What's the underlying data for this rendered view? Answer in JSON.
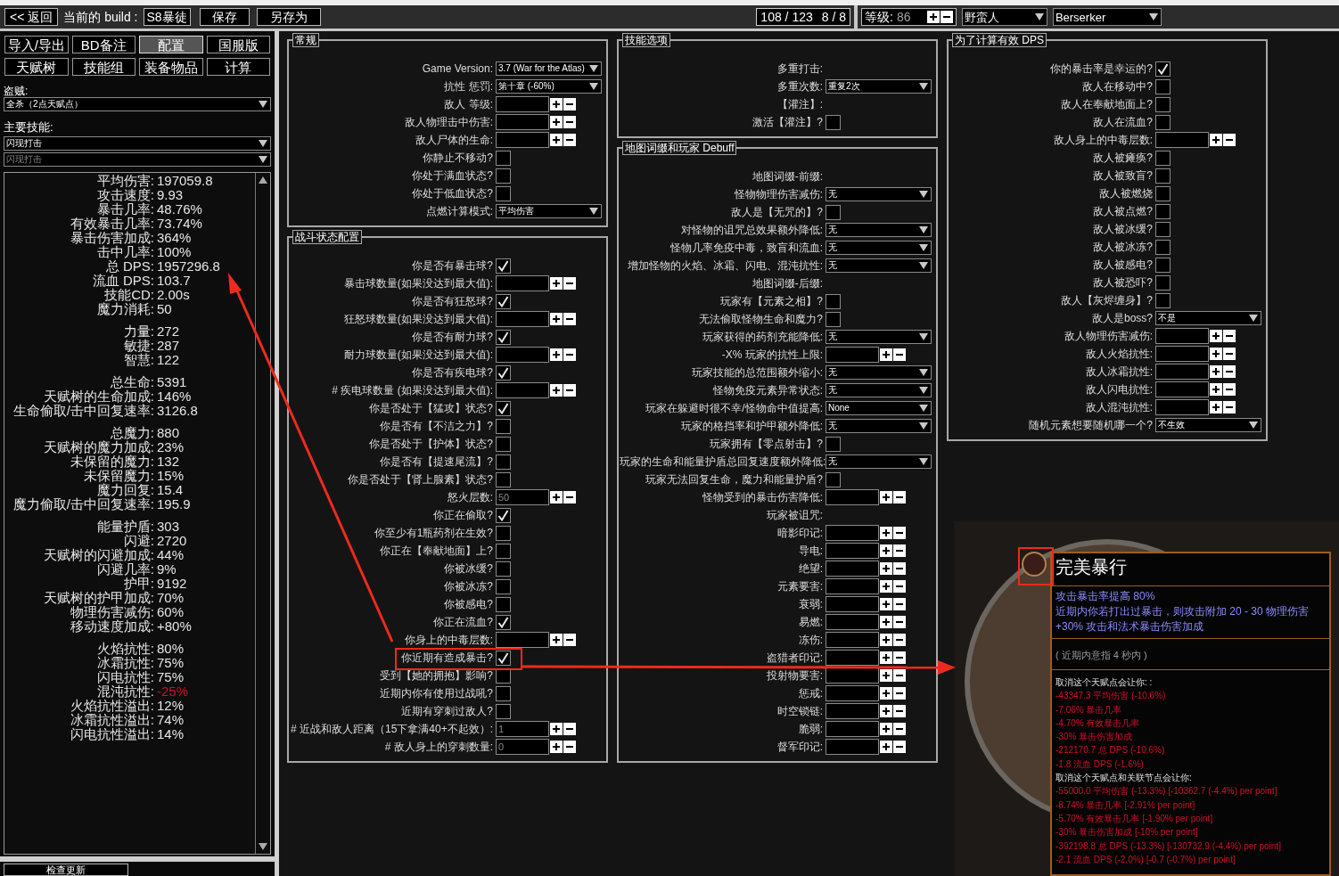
{
  "top_bar": {
    "back_button": "<< 返回",
    "build_label": "当前的 build :",
    "build_name": "S8暴徒",
    "save_button": "保存",
    "save_as_button": "另存为",
    "points": "108 / 123",
    "ascendancy_points": "8 / 8",
    "level_label": "等级:",
    "level_value": "86",
    "class_select": "野蛮人",
    "ascendancy_select": "Berserker"
  },
  "nav_tabs": [
    {
      "label": "导入/导出",
      "selected": false
    },
    {
      "label": "BD备注",
      "selected": false
    },
    {
      "label": "配置",
      "selected": true
    },
    {
      "label": "国服版",
      "selected": false
    },
    {
      "label": "天赋树",
      "selected": false
    },
    {
      "label": "技能组",
      "selected": false
    },
    {
      "label": "装备物品",
      "selected": false
    },
    {
      "label": "计算",
      "selected": false
    }
  ],
  "bandit": {
    "label": "盗贼:",
    "value": "全杀（2点天赋点）"
  },
  "main_skill": {
    "label": "主要技能:",
    "value": "闪现打击",
    "sub_value": "闪现打击"
  },
  "stats": [
    [
      {
        "label": "平均伤害:",
        "value": "197059.8",
        "negative": false
      },
      {
        "label": "攻击速度:",
        "value": "9.93",
        "negative": false
      },
      {
        "label": "暴击几率:",
        "value": "48.76%",
        "negative": false
      },
      {
        "label": "有效暴击几率:",
        "value": "73.74%",
        "negative": false
      },
      {
        "label": "暴击伤害加成:",
        "value": "364%",
        "negative": false
      },
      {
        "label": "击中几率:",
        "value": "100%",
        "negative": false
      },
      {
        "label": "总 DPS:",
        "value": "1957296.8",
        "negative": false
      },
      {
        "label": "流血 DPS:",
        "value": "103.7",
        "negative": false
      },
      {
        "label": "技能CD:",
        "value": "2.00s",
        "negative": false
      },
      {
        "label": "魔力消耗:",
        "value": "50",
        "negative": false
      }
    ],
    [
      {
        "label": "力量:",
        "value": "272",
        "negative": false
      },
      {
        "label": "敏捷:",
        "value": "287",
        "negative": false
      },
      {
        "label": "智慧:",
        "value": "122",
        "negative": false
      }
    ],
    [
      {
        "label": "总生命:",
        "value": "5391",
        "negative": false
      },
      {
        "label": "天赋树的生命加成:",
        "value": "146%",
        "negative": false
      },
      {
        "label": "生命偷取/击中回复速率:",
        "value": "3126.8",
        "negative": false
      }
    ],
    [
      {
        "label": "总魔力:",
        "value": "880",
        "negative": false
      },
      {
        "label": "天赋树的魔力加成:",
        "value": "23%",
        "negative": false
      },
      {
        "label": "未保留的魔力:",
        "value": "132",
        "negative": false
      },
      {
        "label": "未保留魔力:",
        "value": "15%",
        "negative": false
      },
      {
        "label": "魔力回复:",
        "value": "15.4",
        "negative": false
      },
      {
        "label": "魔力偷取/击中回复速率:",
        "value": "195.9",
        "negative": false
      }
    ],
    [
      {
        "label": "能量护盾:",
        "value": "303",
        "negative": false
      },
      {
        "label": "闪避:",
        "value": "2720",
        "negative": false
      },
      {
        "label": "天赋树的闪避加成:",
        "value": "44%",
        "negative": false
      },
      {
        "label": "闪避几率:",
        "value": "9%",
        "negative": false
      },
      {
        "label": "护甲:",
        "value": "9192",
        "negative": false
      },
      {
        "label": "天赋树的护甲加成:",
        "value": "70%",
        "negative": false
      },
      {
        "label": "物理伤害减伤:",
        "value": "60%",
        "negative": false
      },
      {
        "label": "移动速度加成:",
        "value": "+80%",
        "negative": false
      }
    ],
    [
      {
        "label": "火焰抗性:",
        "value": "80%",
        "negative": false
      },
      {
        "label": "冰霜抗性:",
        "value": "75%",
        "negative": false
      },
      {
        "label": "闪电抗性:",
        "value": "75%",
        "negative": false
      },
      {
        "label": "混沌抗性:",
        "value": "-25%",
        "negative": true
      },
      {
        "label": "火焰抗性溢出:",
        "value": "12%",
        "negative": false
      },
      {
        "label": "冰霜抗性溢出:",
        "value": "74%",
        "negative": false
      },
      {
        "label": "闪电抗性溢出:",
        "value": "14%",
        "negative": false
      }
    ]
  ],
  "update_button": "检查更新",
  "columns": [
    [
      {
        "title": "常规",
        "rows": [
          {
            "kind": "select",
            "label": "Game Version:",
            "value": "3.7 (War for the Atlas)"
          },
          {
            "kind": "select",
            "label": "抗性 惩罚:",
            "value": "第十章 (-60%)"
          },
          {
            "kind": "number",
            "label": "敌人 等级:"
          },
          {
            "kind": "number",
            "label": "敌人物理击中伤害:"
          },
          {
            "kind": "number",
            "label": "敌人尸体的生命:"
          },
          {
            "kind": "check",
            "label": "你静止不移动?",
            "checked": false
          },
          {
            "kind": "check",
            "label": "你处于满血状态?",
            "checked": false
          },
          {
            "kind": "check",
            "label": "你处于低血状态?",
            "checked": false
          },
          {
            "kind": "select",
            "label": "点燃计算模式:",
            "value": "平均伤害"
          }
        ]
      },
      {
        "title": "战斗状态配置",
        "rows": [
          {
            "kind": "check",
            "label": "你是否有暴击球?",
            "checked": true
          },
          {
            "kind": "number",
            "label": "暴击球数量(如果没达到最大值):"
          },
          {
            "kind": "check",
            "label": "你是否有狂怒球?",
            "checked": true
          },
          {
            "kind": "number",
            "label": "狂怒球数量(如果没达到最大值):"
          },
          {
            "kind": "check",
            "label": "你是否有耐力球?",
            "checked": true
          },
          {
            "kind": "number",
            "label": "耐力球数量(如果没达到最大值):"
          },
          {
            "kind": "check",
            "label": "你是否有疾电球?",
            "checked": true
          },
          {
            "kind": "number",
            "label": "# 疾电球数量 (如果没达到最大值):"
          },
          {
            "kind": "check",
            "label": "你是否处于【猛攻】状态?",
            "checked": true
          },
          {
            "kind": "check",
            "label": "你是否有【不洁之力】?",
            "checked": false
          },
          {
            "kind": "check",
            "label": "你是否处于【护体】状态?",
            "checked": false
          },
          {
            "kind": "check",
            "label": "你是否有【提速尾流】?",
            "checked": false
          },
          {
            "kind": "check",
            "label": "你是否处于【肾上腺素】状态?",
            "checked": false
          },
          {
            "kind": "number",
            "label": "怒火层数:",
            "placeholder": "50"
          },
          {
            "kind": "check",
            "label": "你正在偷取?",
            "checked": true
          },
          {
            "kind": "check",
            "label": "你至少有1瓶药剂在生效?",
            "checked": false
          },
          {
            "kind": "check",
            "label": "你正在【奉献地面】上?",
            "checked": false
          },
          {
            "kind": "check",
            "label": "你被冰缓?",
            "checked": false
          },
          {
            "kind": "check",
            "label": "你被冰冻?",
            "checked": false
          },
          {
            "kind": "check",
            "label": "你被感电?",
            "checked": false
          },
          {
            "kind": "check",
            "label": "你正在流血?",
            "checked": true
          },
          {
            "kind": "number",
            "label": "你身上的中毒层数:"
          },
          {
            "kind": "check",
            "label": "你近期有造成暴击?",
            "checked": true
          },
          {
            "kind": "check",
            "label": "受到【她的拥抱】影响?",
            "checked": false
          },
          {
            "kind": "check",
            "label": "近期内你有使用过战吼?",
            "checked": false
          },
          {
            "kind": "check",
            "label": "近期有穿刺过敌人?",
            "checked": false
          },
          {
            "kind": "number",
            "label": "# 近战和敌人距离（15下拿满40+不起效）:",
            "placeholder": "1"
          },
          {
            "kind": "number",
            "label": "# 敌人身上的穿刺数量:",
            "placeholder": "0"
          }
        ]
      }
    ],
    [
      {
        "title": "技能选项",
        "rows": [
          {
            "kind": "heading",
            "label": "多重打击:"
          },
          {
            "kind": "select",
            "label": "多重次数:",
            "value": "重复2次"
          },
          {
            "kind": "heading",
            "label": "【灌注】:"
          },
          {
            "kind": "check",
            "label": "激活【灌注】?",
            "checked": false
          }
        ]
      },
      {
        "title": "地图词缀和玩家 Debuff",
        "rows": [
          {
            "kind": "heading",
            "label": "地图词缀-前缀:"
          },
          {
            "kind": "select",
            "label": "怪物物理伤害减伤:",
            "value": "无"
          },
          {
            "kind": "check",
            "label": "敌人是【无咒的】?",
            "checked": false
          },
          {
            "kind": "select",
            "label": "对怪物的诅咒总效果额外降低:",
            "value": "无"
          },
          {
            "kind": "select",
            "label": "怪物几率免疫中毒，致盲和流血:",
            "value": "无"
          },
          {
            "kind": "select",
            "label": "增加怪物的火焰、冰霜、闪电、混沌抗性:",
            "value": "无"
          },
          {
            "kind": "heading",
            "label": "地图词缀-后缀:"
          },
          {
            "kind": "check",
            "label": "玩家有【元素之相】?",
            "checked": false
          },
          {
            "kind": "check",
            "label": "无法偷取怪物生命和魔力?",
            "checked": false
          },
          {
            "kind": "select",
            "label": "玩家获得的药剂充能降低:",
            "value": "无"
          },
          {
            "kind": "number",
            "label": "-X% 玩家的抗性上限:"
          },
          {
            "kind": "select",
            "label": "玩家技能的总范围额外缩小:",
            "value": "无"
          },
          {
            "kind": "select",
            "label": "怪物免疫元素异常状态:",
            "value": "无"
          },
          {
            "kind": "select",
            "label": "玩家在躲避时很不幸/怪物命中值提高:",
            "value": "None"
          },
          {
            "kind": "select",
            "label": "玩家的格挡率和护甲额外降低:",
            "value": "无"
          },
          {
            "kind": "check",
            "label": "玩家拥有【零点射击】?",
            "checked": false
          },
          {
            "kind": "select",
            "label": "玩家的生命和能量护盾总回复速度额外降低:",
            "value": "无"
          },
          {
            "kind": "check",
            "label": "玩家无法回复生命，魔力和能量护盾?",
            "checked": false
          },
          {
            "kind": "number",
            "label": "怪物受到的暴击伤害降低:"
          },
          {
            "kind": "heading",
            "label": "玩家被诅咒:"
          },
          {
            "kind": "number",
            "label": "暗影印记:"
          },
          {
            "kind": "number",
            "label": "导电:"
          },
          {
            "kind": "number",
            "label": "绝望:"
          },
          {
            "kind": "number",
            "label": "元素要害:"
          },
          {
            "kind": "number",
            "label": "衰弱:"
          },
          {
            "kind": "number",
            "label": "易燃:"
          },
          {
            "kind": "number",
            "label": "冻伤:"
          },
          {
            "kind": "number",
            "label": "盗猎者印记:"
          },
          {
            "kind": "number",
            "label": "投射物要害:"
          },
          {
            "kind": "number",
            "label": "惩戒:"
          },
          {
            "kind": "number",
            "label": "时空锁链:"
          },
          {
            "kind": "number",
            "label": "脆弱:"
          },
          {
            "kind": "number",
            "label": "督军印记:"
          }
        ]
      }
    ],
    [
      {
        "title": "为了计算有效 DPS",
        "rows": [
          {
            "kind": "check",
            "label": "你的暴击率是幸运的?",
            "checked": true
          },
          {
            "kind": "check",
            "label": "敌人在移动中?",
            "checked": false
          },
          {
            "kind": "check",
            "label": "敌人在奉献地面上?",
            "checked": false
          },
          {
            "kind": "check",
            "label": "敌人在流血?",
            "checked": false
          },
          {
            "kind": "number",
            "label": "敌人身上的中毒层数:"
          },
          {
            "kind": "check",
            "label": "敌人被瘫痪?",
            "checked": false
          },
          {
            "kind": "check",
            "label": "敌人被致盲?",
            "checked": false
          },
          {
            "kind": "check",
            "label": "敌人被燃烧",
            "checked": false
          },
          {
            "kind": "check",
            "label": "敌人被点燃?",
            "checked": false
          },
          {
            "kind": "check",
            "label": "敌人被冰缓?",
            "checked": false
          },
          {
            "kind": "check",
            "label": "敌人被冰冻?",
            "checked": false
          },
          {
            "kind": "check",
            "label": "敌人被感电?",
            "checked": false
          },
          {
            "kind": "check",
            "label": "敌人被恐吓?",
            "checked": false
          },
          {
            "kind": "check",
            "label": "敌人【灰烬缠身】?",
            "checked": false
          },
          {
            "kind": "select",
            "label": "敌人是boss?",
            "value": "不是"
          },
          {
            "kind": "number",
            "label": "敌人物理伤害减伤:"
          },
          {
            "kind": "number",
            "label": "敌人火焰抗性:"
          },
          {
            "kind": "number",
            "label": "敌人冰霜抗性:"
          },
          {
            "kind": "number",
            "label": "敌人闪电抗性:"
          },
          {
            "kind": "number",
            "label": "敌人混沌抗性:"
          },
          {
            "kind": "select",
            "label": "随机元素想要随机哪一个?",
            "value": "不生效"
          }
        ]
      }
    ]
  ],
  "tooltip": {
    "title": "完美暴行",
    "mods": [
      "攻击暴击率提高 80%",
      "近期内你若打出过暴击，则攻击附加 20 - 30 物理伤害",
      "+30% 攻击和法术暴击伤害加成"
    ],
    "reminder": "( 近期内意指 4 秒内 )",
    "lines": [
      {
        "kind": "header",
        "text": "取消这个天赋点会让你: :"
      },
      {
        "kind": "loss",
        "text": "-43347.3 平均伤害 (-10.6%)"
      },
      {
        "kind": "loss",
        "text": "-7.06% 暴击几率"
      },
      {
        "kind": "loss",
        "text": "-4.70% 有效暴击几率"
      },
      {
        "kind": "loss",
        "text": "-30% 暴击伤害加成"
      },
      {
        "kind": "loss",
        "text": "-212170.7 总 DPS (-10.6%)"
      },
      {
        "kind": "loss",
        "text": "-1.8 流血 DPS (-1.6%)"
      },
      {
        "kind": "header",
        "text": "取消这个天赋点和关联节点会让你:"
      },
      {
        "kind": "loss",
        "text": "-55000.0 平均伤害 (-13.3%) [-10362.7 (-4.4%) per point]"
      },
      {
        "kind": "loss",
        "text": "-8.74% 暴击几率 [-2.91% per point]"
      },
      {
        "kind": "loss",
        "text": "-5.70% 有效暴击几率 [-1.90% per point]"
      },
      {
        "kind": "loss",
        "text": "-30% 暴击伤害加成 [-10% per point]"
      },
      {
        "kind": "loss",
        "text": "-392198.8 总 DPS (-13.3%) [-130732.9 (-4.4%) per point]"
      },
      {
        "kind": "loss",
        "text": "-2.1 流血 DPS (-2.0%) [-0.7 (-0.7%) per point]"
      }
    ]
  }
}
